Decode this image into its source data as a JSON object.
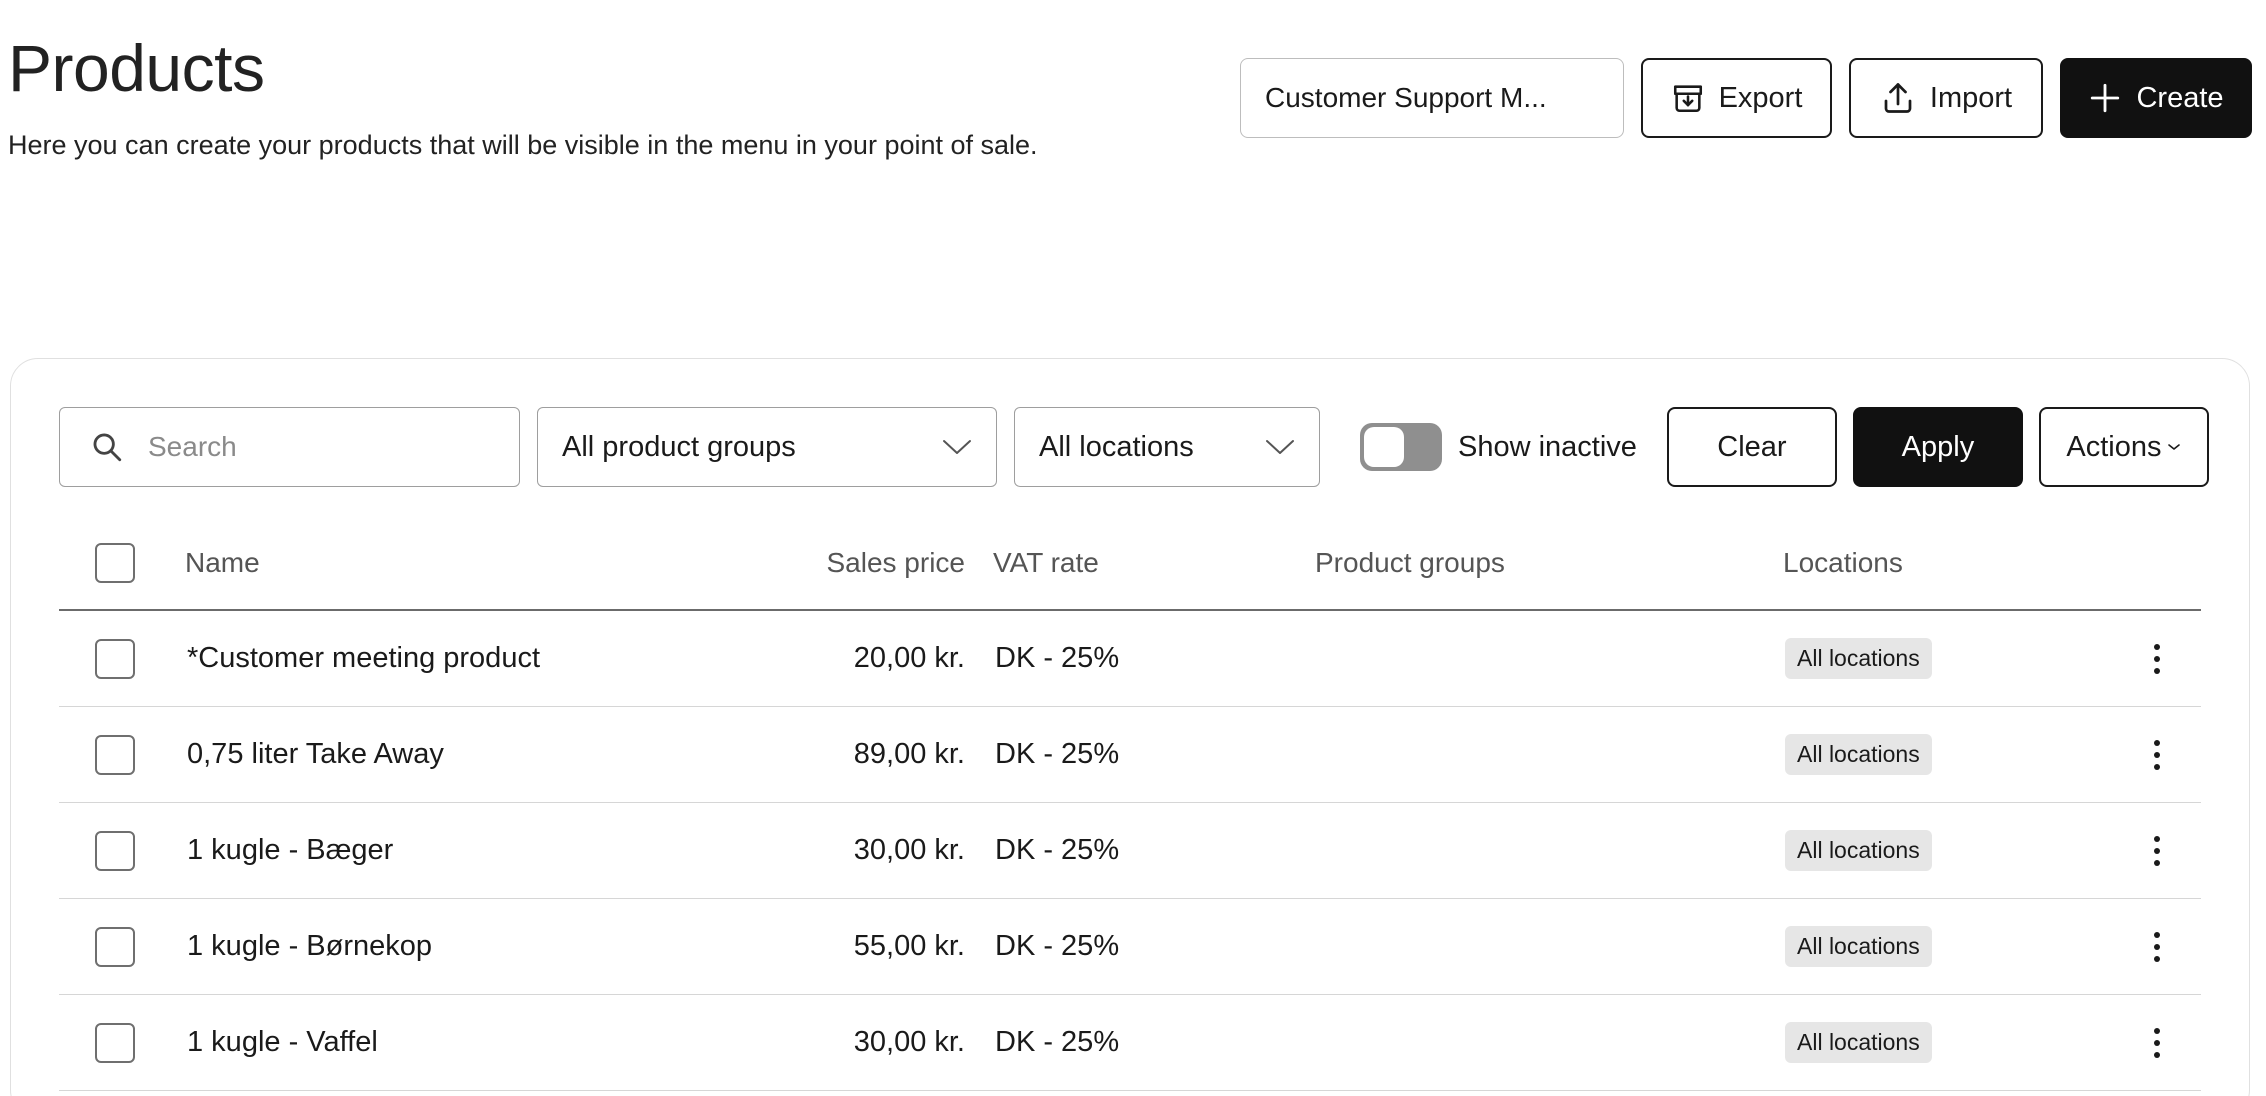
{
  "header": {
    "title": "Products",
    "subtitle": "Here you can create your products that will be visible in the menu in your point of sale.",
    "org_select": "Customer Support M...",
    "export_label": "Export",
    "import_label": "Import",
    "create_label": "Create"
  },
  "filters": {
    "search_placeholder": "Search",
    "product_groups": "All product groups",
    "locations": "All locations",
    "show_inactive_label": "Show inactive",
    "show_inactive_on": false,
    "clear_label": "Clear",
    "apply_label": "Apply",
    "actions_label": "Actions"
  },
  "table": {
    "columns": {
      "name": "Name",
      "sales_price": "Sales price",
      "vat_rate": "VAT rate",
      "product_groups": "Product groups",
      "locations": "Locations"
    },
    "rows": [
      {
        "name": "*Customer meeting product",
        "price": "20,00 kr.",
        "vat": "DK - 25%",
        "groups": "",
        "location": "All locations"
      },
      {
        "name": "0,75 liter Take Away",
        "price": "89,00 kr.",
        "vat": "DK - 25%",
        "groups": "",
        "location": "All locations"
      },
      {
        "name": "1 kugle - Bæger",
        "price": "30,00 kr.",
        "vat": "DK - 25%",
        "groups": "",
        "location": "All locations"
      },
      {
        "name": "1 kugle - Børnekop",
        "price": "55,00 kr.",
        "vat": "DK - 25%",
        "groups": "",
        "location": "All locations"
      },
      {
        "name": "1 kugle - Vaffel",
        "price": "30,00 kr.",
        "vat": "DK - 25%",
        "groups": "",
        "location": "All locations"
      }
    ]
  },
  "icons": {
    "export": "archive-download-icon",
    "import": "upload-icon",
    "create": "plus-icon",
    "search": "search-icon",
    "dropdown": "chevron-down-icon",
    "row_menu": "more-vertical-icon"
  },
  "colors": {
    "primary_button": "#111111",
    "toggle_off": "#8f8f8f",
    "badge_bg": "#e6e6e6"
  }
}
